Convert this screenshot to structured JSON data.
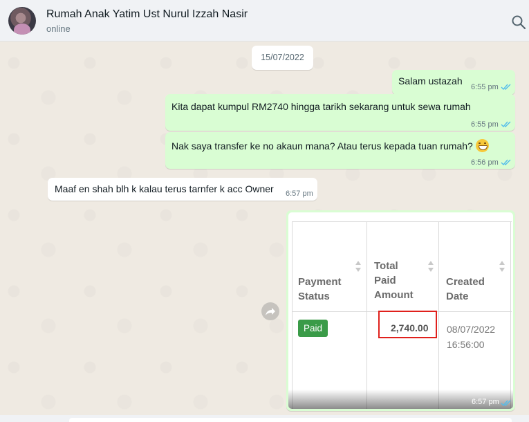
{
  "header": {
    "contact_name": "Rumah Anak Yatim Ust Nurul Izzah Nasir",
    "status": "online",
    "search_icon": "search-icon"
  },
  "chat": {
    "date_divider": "15/07/2022",
    "messages": [
      {
        "direction": "out",
        "text": "Salam ustazah",
        "time": "6:55 pm",
        "status": "read"
      },
      {
        "direction": "out",
        "text": "Kita dapat kumpul RM2740 hingga tarikh sekarang untuk sewa rumah",
        "time": "6:55 pm",
        "status": "read"
      },
      {
        "direction": "out",
        "text": "Nak saya transfer ke no akaun mana? Atau terus kepada tuan rumah?",
        "time": "6:56 pm",
        "status": "read",
        "emoji": "grinning-face-emoji"
      },
      {
        "direction": "in",
        "text": "Maaf en shah blh k kalau terus tarnfer k acc Owner",
        "time": "6:57 pm"
      }
    ],
    "image_message": {
      "direction": "out",
      "time": "6:57 pm",
      "status": "read",
      "table": {
        "headers": [
          [
            "Payment",
            "Status"
          ],
          [
            "Total",
            "Paid",
            "Amount"
          ],
          [
            "Created",
            "Date"
          ]
        ],
        "row": {
          "status_badge": "Paid",
          "amount": "2,740.00",
          "created_date": "08/07/2022",
          "created_time": "16:56:00"
        }
      }
    }
  },
  "colors": {
    "outgoing_bubble": "#d9fdd3",
    "incoming_bubble": "#ffffff",
    "read_ticks": "#53bdeb",
    "paid_badge": "#3a9b48",
    "highlight_box": "#e0201c"
  }
}
